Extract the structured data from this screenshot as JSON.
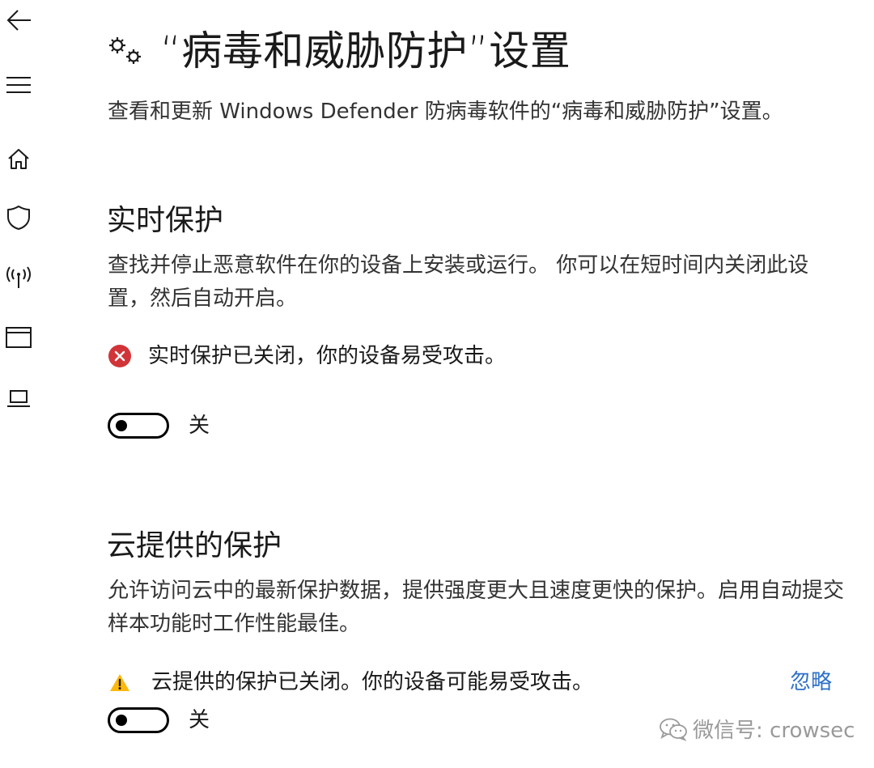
{
  "nav": {
    "items": [
      {
        "icon": "back-arrow-icon"
      },
      {
        "icon": "hamburger-menu-icon"
      },
      {
        "icon": "home-icon"
      },
      {
        "icon": "shield-icon"
      },
      {
        "icon": "wireless-antenna-icon"
      },
      {
        "icon": "app-browser-window-icon"
      },
      {
        "icon": "laptop-device-icon"
      }
    ]
  },
  "header": {
    "icon": "gears-icon",
    "title": "“病毒和威胁防护”设置",
    "subtitle": "查看和更新 Windows Defender 防病毒软件的“病毒和威胁防护”设置。"
  },
  "realtime": {
    "heading": "实时保护",
    "description": "查找并停止恶意软件在你的设备上安装或运行。 你可以在短时间内关闭此设置，然后自动开启。",
    "status_icon": "error-circle-icon",
    "status_text": "实时保护已关闭，你的设备易受攻击。",
    "status_color": "#d13438",
    "toggle_label": "关",
    "toggle_on": false
  },
  "cloud": {
    "heading": "云提供的保护",
    "description": "允许访问云中的最新保护数据，提供强度更大且速度更快的保护。启用自动提交样本功能时工作性能最佳。",
    "status_icon": "warning-triangle-icon",
    "status_text": "云提供的保护已关闭。你的设备可能易受攻击。",
    "status_color": "#fcb80f",
    "dismiss_label": "忽略",
    "toggle_label": "关",
    "toggle_on": false
  },
  "watermark": {
    "icon": "wechat-icon",
    "text": "微信号: crowsec"
  },
  "colors": {
    "link": "#2e70c8",
    "text": "#1a1a1a"
  }
}
